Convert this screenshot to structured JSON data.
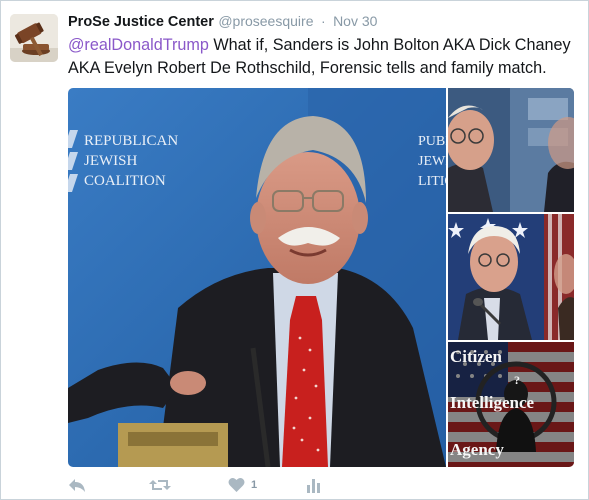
{
  "tweet": {
    "author_name": "ProSe Justice Center",
    "handle": "@proseesquire",
    "separator": "·",
    "time": "Nov 30",
    "mention": "@realDonaldTrump",
    "text": " What if, Sanders is John Bolton AKA Dick Chaney AKA Evelyn Robert De Rothschild, Forensic tells and family match."
  },
  "media": {
    "main_backdrop_text": [
      "REPUBLICAN",
      "JEWISH",
      "COALITION"
    ],
    "side_backdrop_text": [
      "PUBLIC",
      "JEWISH",
      "LITION"
    ],
    "overlay_words": [
      "Citizen",
      "Intelligence",
      "Agency"
    ]
  },
  "actions": {
    "like_count": "1"
  },
  "colors": {
    "mention": "#8a58c9",
    "icon": "#aab8c2",
    "backdrop_blue": "#2e6eb8"
  },
  "icons": [
    "reply-icon",
    "retweet-icon",
    "like-icon",
    "analytics-icon"
  ]
}
